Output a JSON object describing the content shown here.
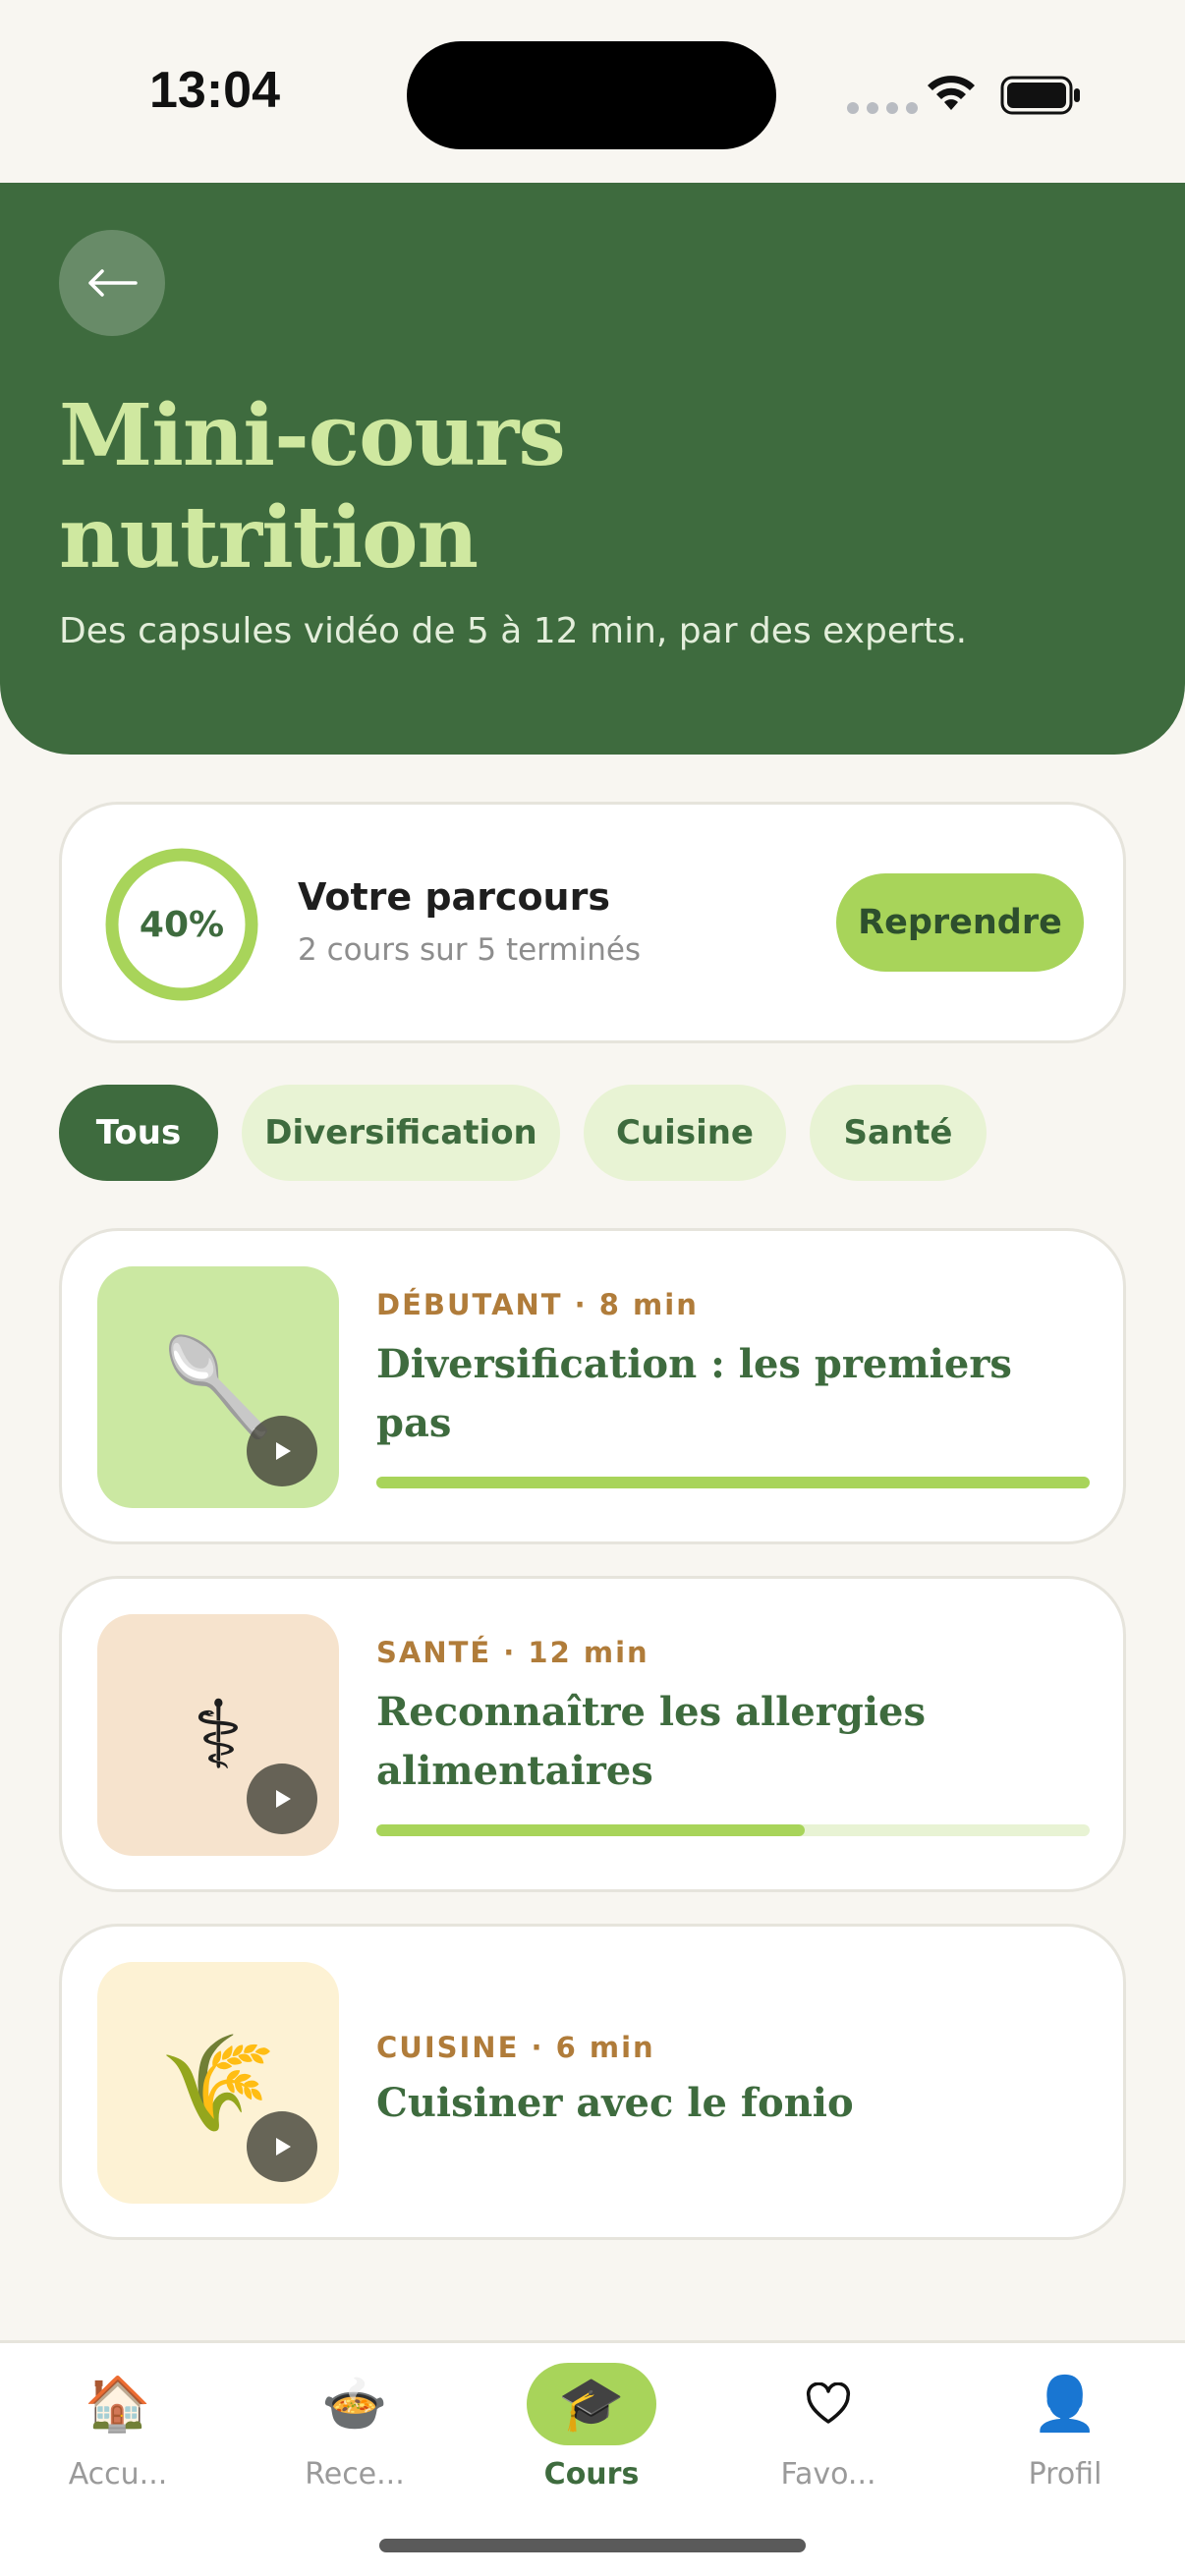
{
  "status_bar": {
    "time": "13:04"
  },
  "header": {
    "title": "Mini-cours nutrition",
    "subtitle": "Des capsules vidéo de 5 à 12 min, par des experts."
  },
  "progress": {
    "percent_label": "40%",
    "percent": 0.4,
    "title": "Votre parcours",
    "subtitle": "2 cours sur 5 terminés",
    "resume_label": "Reprendre"
  },
  "filters": [
    {
      "label": "Tous",
      "active": true
    },
    {
      "label": "Diversification",
      "active": false
    },
    {
      "label": "Cuisine",
      "active": false
    },
    {
      "label": "Santé",
      "active": false
    }
  ],
  "courses": [
    {
      "meta": "DÉBUTANT · 8 min",
      "title": "Diversification : les premiers pas",
      "icon": "spoon-icon",
      "emoji": "🥄",
      "thumb_color": "#cbe8a2",
      "progress": 1.0
    },
    {
      "meta": "SANTÉ · 12 min",
      "title": "Reconnaître les allergies alimentaires",
      "icon": "medical-icon",
      "emoji": "⚕",
      "thumb_color": "#f6e3cd",
      "progress": 0.6
    },
    {
      "meta": "CUISINE · 6 min",
      "title": "Cuisiner avec le fonio",
      "icon": "grain-icon",
      "emoji": "🌾",
      "thumb_color": "#fdf2d4",
      "progress": null
    }
  ],
  "tabs": [
    {
      "label": "Accu...",
      "icon": "house-icon",
      "emoji": "🏠",
      "active": false
    },
    {
      "label": "Rece...",
      "icon": "bowl-icon",
      "emoji": "🍲",
      "active": false
    },
    {
      "label": "Cours",
      "icon": "graduation-cap-icon",
      "emoji": "🎓",
      "active": true
    },
    {
      "label": "Favo...",
      "icon": "heart-icon",
      "emoji": "♡",
      "active": false
    },
    {
      "label": "Profil",
      "icon": "user-icon",
      "emoji": "👤",
      "active": false
    }
  ],
  "colors": {
    "primary": "#3e6b3e",
    "accent": "#a8d45a",
    "title_light": "#cfe8a0",
    "meta": "#b07c3a"
  }
}
